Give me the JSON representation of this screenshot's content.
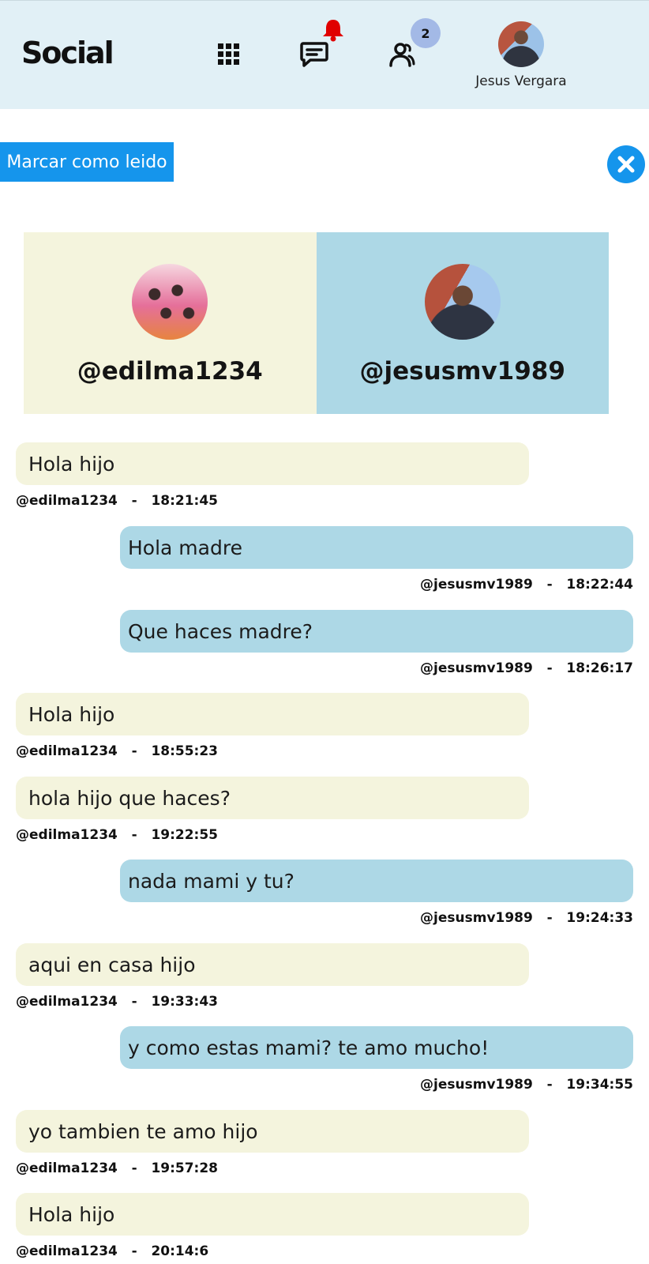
{
  "header": {
    "logo": "Social",
    "notification_badge_count": "2",
    "user_name": "Jesus Vergara",
    "icons": [
      "grid-icon",
      "chat-icon",
      "bell-icon",
      "users-icon"
    ]
  },
  "actions": {
    "mark_read_label": "Marcar como leido"
  },
  "colors": {
    "accent": "#1595ec",
    "header_bg": "#e1f0f6",
    "incoming_bg": "#f4f4dd",
    "outgoing_bg": "#add8e6",
    "bell": "#e00000",
    "badge": "#a3b9e6"
  },
  "profiles": {
    "left": {
      "handle": "@edilma1234"
    },
    "right": {
      "handle": "@jesusmv1989"
    }
  },
  "messages": [
    {
      "dir": "in",
      "text": "Hola hijo",
      "user": "@edilma1234",
      "time": "18:21:45"
    },
    {
      "dir": "out",
      "text": "Hola madre",
      "user": "@jesusmv1989",
      "time": "18:22:44"
    },
    {
      "dir": "out",
      "text": "Que haces madre?",
      "user": "@jesusmv1989",
      "time": "18:26:17"
    },
    {
      "dir": "in",
      "text": "Hola hijo",
      "user": "@edilma1234",
      "time": "18:55:23"
    },
    {
      "dir": "in",
      "text": "hola hijo que haces?",
      "user": "@edilma1234",
      "time": "19:22:55"
    },
    {
      "dir": "out",
      "text": "nada mami y tu?",
      "user": "@jesusmv1989",
      "time": "19:24:33"
    },
    {
      "dir": "in",
      "text": "aqui en casa hijo",
      "user": "@edilma1234",
      "time": "19:33:43"
    },
    {
      "dir": "out",
      "text": "y como estas mami? te amo mucho!",
      "user": "@jesusmv1989",
      "time": "19:34:55"
    },
    {
      "dir": "in",
      "text": "yo tambien te amo hijo",
      "user": "@edilma1234",
      "time": "19:57:28"
    },
    {
      "dir": "in",
      "text": "Hola hijo",
      "user": "@edilma1234",
      "time": "20:14:6"
    }
  ]
}
